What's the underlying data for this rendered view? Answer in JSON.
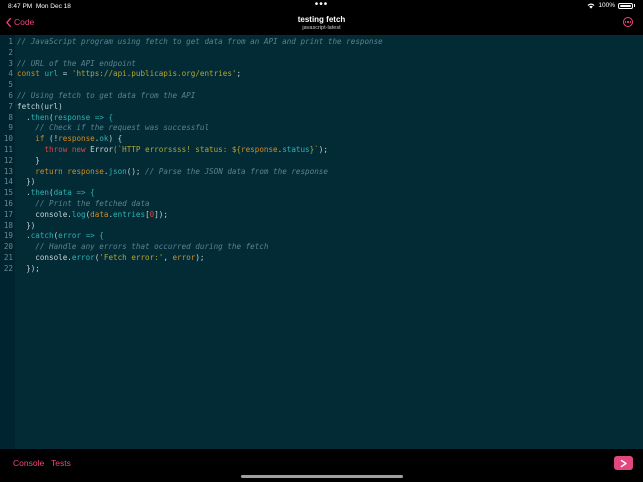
{
  "status_bar": {
    "time": "8:47 PM",
    "date": "Mon Dec 18",
    "dots": "•••",
    "battery_text": "100%"
  },
  "nav": {
    "back_label": "Code",
    "title": "testing fetch",
    "subtitle": "javascript-latest"
  },
  "editor": {
    "line_numbers": [
      "1",
      "2",
      "3",
      "4",
      "5",
      "6",
      "7",
      "8",
      "9",
      "10",
      "11",
      "12",
      "13",
      "14",
      "15",
      "16",
      "17",
      "18",
      "19",
      "20",
      "21",
      "22"
    ],
    "lines": [
      [
        {
          "t": "// JavaScript program using fetch to get data from an API and print the response",
          "c": "comment"
        }
      ],
      [],
      [
        {
          "t": "// URL of the API endpoint",
          "c": "comment"
        }
      ],
      [
        {
          "t": "const ",
          "c": "kw"
        },
        {
          "t": "url",
          "c": "var"
        },
        {
          "t": " = ",
          "c": "plain"
        },
        {
          "t": "'https://api.publicapis.org/entries'",
          "c": "str"
        },
        {
          "t": ";",
          "c": "plain"
        }
      ],
      [],
      [
        {
          "t": "// Using fetch to get data from the API",
          "c": "comment"
        }
      ],
      [
        {
          "t": "fetch",
          "c": "plain"
        },
        {
          "t": "(url)",
          "c": "plain"
        }
      ],
      [
        {
          "t": "  .",
          "c": "plain"
        },
        {
          "t": "then",
          "c": "var"
        },
        {
          "t": "(",
          "c": "plain"
        },
        {
          "t": "response",
          "c": "var"
        },
        {
          "t": " => {",
          "c": "var"
        }
      ],
      [
        {
          "t": "    // Check if the request was successful",
          "c": "comment"
        }
      ],
      [
        {
          "t": "    if ",
          "c": "kw"
        },
        {
          "t": "(!",
          "c": "plain"
        },
        {
          "t": "response",
          "c": "kw"
        },
        {
          "t": ".",
          "c": "plain"
        },
        {
          "t": "ok",
          "c": "var"
        },
        {
          "t": ") {",
          "c": "plain"
        }
      ],
      [
        {
          "t": "      throw new ",
          "c": "red"
        },
        {
          "t": "Error",
          "c": "plain"
        },
        {
          "t": "(`HTTP errorssss! status: ${",
          "c": "str"
        },
        {
          "t": "response",
          "c": "kw"
        },
        {
          "t": ".",
          "c": "plain"
        },
        {
          "t": "status",
          "c": "var"
        },
        {
          "t": "}`",
          "c": "str"
        },
        {
          "t": ");",
          "c": "plain"
        }
      ],
      [
        {
          "t": "    }",
          "c": "plain"
        }
      ],
      [
        {
          "t": "    return ",
          "c": "kw"
        },
        {
          "t": "response",
          "c": "kw"
        },
        {
          "t": ".",
          "c": "plain"
        },
        {
          "t": "json",
          "c": "var"
        },
        {
          "t": "(); ",
          "c": "plain"
        },
        {
          "t": "// Parse the JSON data from the response",
          "c": "comment"
        }
      ],
      [
        {
          "t": "  })",
          "c": "plain"
        }
      ],
      [
        {
          "t": "  .",
          "c": "plain"
        },
        {
          "t": "then",
          "c": "var"
        },
        {
          "t": "(",
          "c": "plain"
        },
        {
          "t": "data",
          "c": "var"
        },
        {
          "t": " => {",
          "c": "var"
        }
      ],
      [
        {
          "t": "    // Print the fetched data",
          "c": "comment"
        }
      ],
      [
        {
          "t": "    console.",
          "c": "plain"
        },
        {
          "t": "log",
          "c": "var"
        },
        {
          "t": "(",
          "c": "plain"
        },
        {
          "t": "data",
          "c": "kw"
        },
        {
          "t": ".",
          "c": "plain"
        },
        {
          "t": "entries",
          "c": "var"
        },
        {
          "t": "[",
          "c": "plain"
        },
        {
          "t": "0",
          "c": "red"
        },
        {
          "t": "]);",
          "c": "plain"
        }
      ],
      [
        {
          "t": "  })",
          "c": "plain"
        }
      ],
      [
        {
          "t": "  .",
          "c": "plain"
        },
        {
          "t": "catch",
          "c": "var"
        },
        {
          "t": "(",
          "c": "plain"
        },
        {
          "t": "error",
          "c": "var"
        },
        {
          "t": " => {",
          "c": "var"
        }
      ],
      [
        {
          "t": "    // Handle any errors that occurred during the fetch",
          "c": "comment"
        }
      ],
      [
        {
          "t": "    console.",
          "c": "plain"
        },
        {
          "t": "error",
          "c": "var"
        },
        {
          "t": "(",
          "c": "plain"
        },
        {
          "t": "'Fetch error:'",
          "c": "str"
        },
        {
          "t": ", ",
          "c": "plain"
        },
        {
          "t": "error",
          "c": "kw"
        },
        {
          "t": ");",
          "c": "plain"
        }
      ],
      [
        {
          "t": "  });",
          "c": "plain"
        }
      ]
    ]
  },
  "bottom_bar": {
    "tabs": [
      "Console",
      "Tests"
    ],
    "run_icon": "play-icon"
  },
  "colors": {
    "accent": "#f0467a",
    "editor_bg": "#022b36",
    "comment": "#5b8390",
    "keyword": "#d08c24",
    "string": "#b3a530",
    "variable": "#2fb2b3"
  }
}
